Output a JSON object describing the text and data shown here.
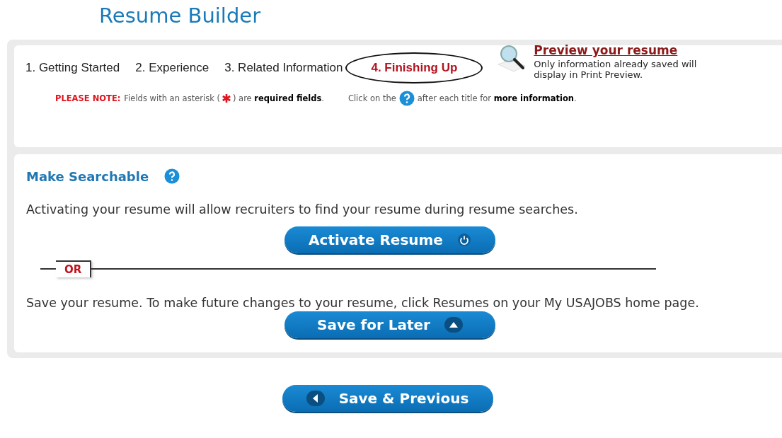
{
  "title": "Resume Builder",
  "steps": [
    {
      "label": "1. Getting Started",
      "selected": false
    },
    {
      "label": "2. Experience",
      "selected": false
    },
    {
      "label": "3. Related Information",
      "selected": false
    },
    {
      "label": "4. Finishing Up",
      "selected": true
    }
  ],
  "preview": {
    "link": "Preview your resume",
    "text": "Only information already saved will display in Print Preview."
  },
  "note": {
    "label": "PLEASE NOTE:",
    "before": "Fields with an asterisk (",
    "after": ") are **required fields**.",
    "help_before": "Click on the",
    "help_after": "after each title for **more information**."
  },
  "section": {
    "title": "Make Searchable",
    "intro": "Activating your resume will allow recruiters to find your resume during resume searches.",
    "divider": "OR",
    "save_text": "Save your resume. To make future changes to your resume, click Resumes on your My USAJOBS home page."
  },
  "buttons": [
    {
      "label": "Activate Resume",
      "kind": "power"
    },
    {
      "label": "Save for Later",
      "kind": "up"
    },
    {
      "label": "Save & Previous",
      "kind": "back"
    }
  ]
}
